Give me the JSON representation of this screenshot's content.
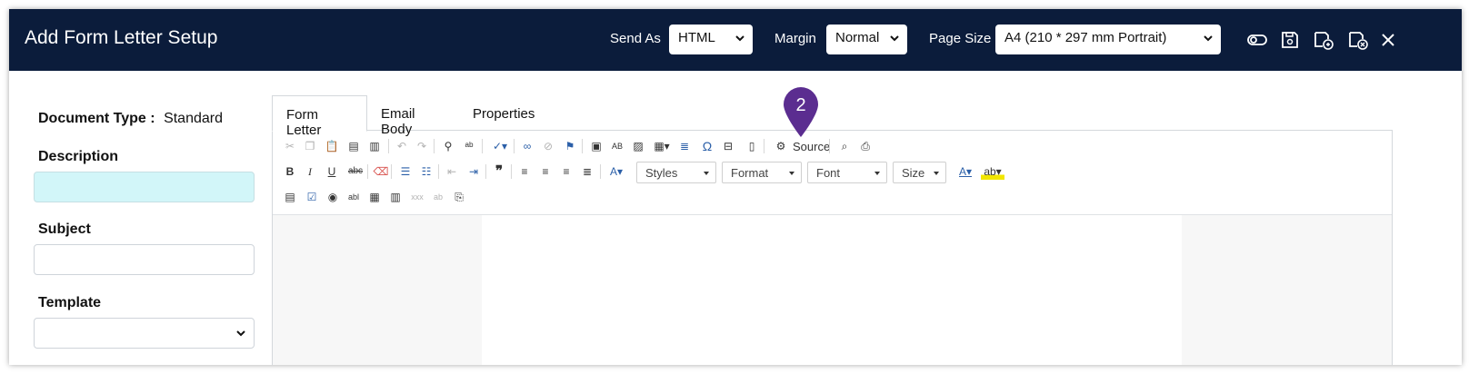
{
  "header": {
    "title": "Add Form Letter Setup",
    "send_as_label": "Send As",
    "send_as_value": "HTML",
    "margin_label": "Margin",
    "margin_value": "Normal",
    "page_size_label": "Page Size",
    "page_size_value": "A4 (210 * 297 mm Portrait)",
    "bg_color": "#0b1c3b",
    "icons": [
      "toggle-icon",
      "save-icon",
      "save-copy-icon",
      "save-close-icon",
      "close-icon"
    ]
  },
  "left_panel": {
    "document_type_label": "Document Type :",
    "document_type_value": "Standard",
    "description_label": "Description",
    "description_value": "",
    "subject_label": "Subject",
    "subject_value": "",
    "template_label": "Template",
    "template_value": "",
    "description_bg": "#d2f6f9"
  },
  "tabs": [
    "Form Letter",
    "Email Body",
    "Properties"
  ],
  "active_tab": "Form Letter",
  "toolbar": {
    "source_label": "Source",
    "styles_label": "Styles",
    "format_label": "Format",
    "font_label": "Font",
    "size_label": "Size",
    "bold": "B",
    "italic": "I",
    "underline": "U",
    "strike": "abc",
    "omega": "Ω",
    "quote": "❞"
  },
  "callout": {
    "number": "2",
    "color": "#5b2d90"
  }
}
